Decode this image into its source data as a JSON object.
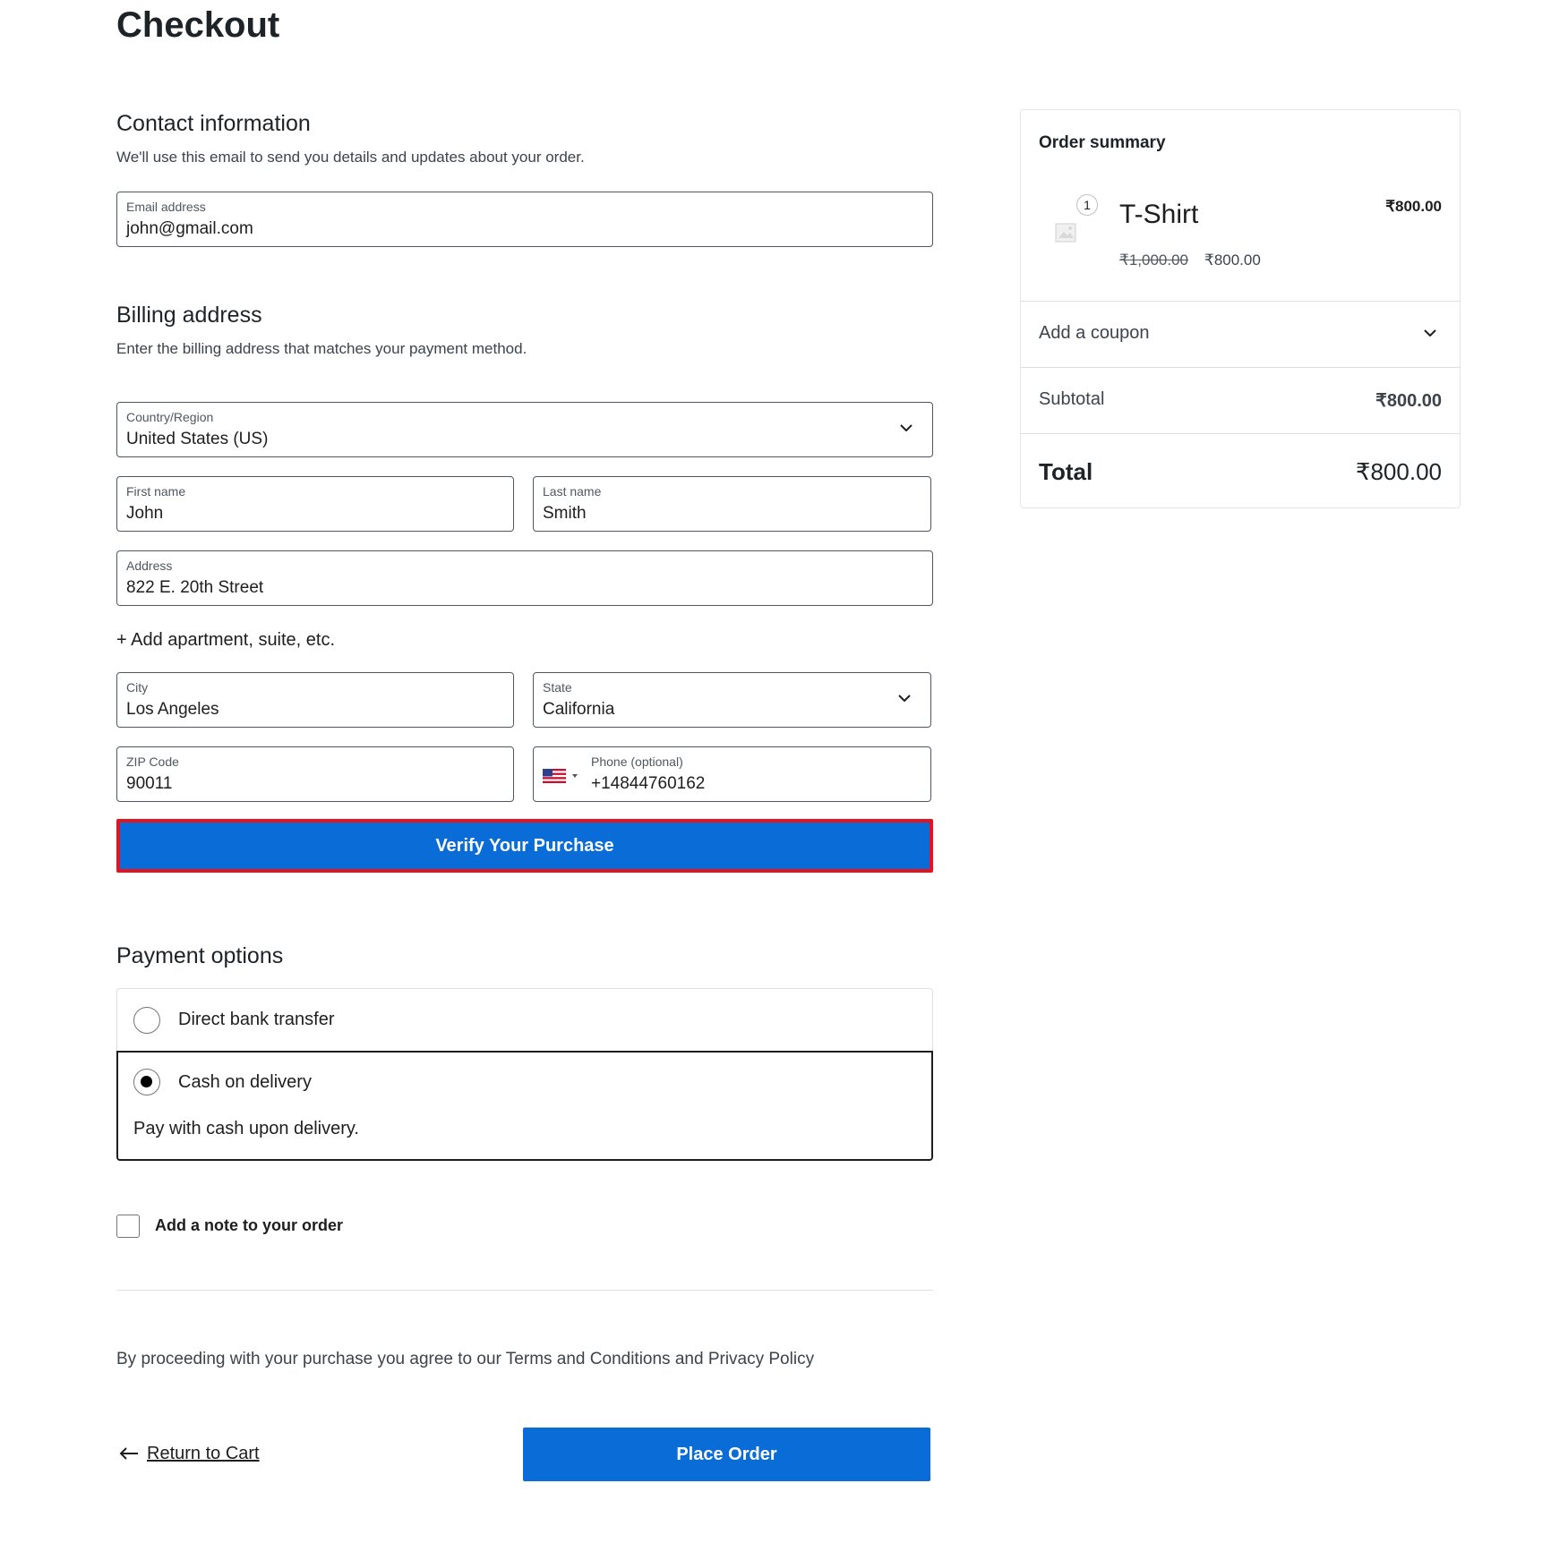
{
  "page": {
    "title": "Checkout"
  },
  "contact": {
    "heading": "Contact information",
    "description": "We'll use this email to send you details and updates about your order.",
    "email_label": "Email address",
    "email_value": "john@gmail.com"
  },
  "billing": {
    "heading": "Billing address",
    "description": "Enter the billing address that matches your payment method.",
    "country_label": "Country/Region",
    "country_value": "United States (US)",
    "first_name_label": "First name",
    "first_name_value": "John",
    "last_name_label": "Last name",
    "last_name_value": "Smith",
    "address_label": "Address",
    "address_value": "822 E. 20th Street",
    "add_apartment": "+ Add apartment, suite, etc.",
    "city_label": "City",
    "city_value": "Los Angeles",
    "state_label": "State",
    "state_value": "California",
    "zip_label": "ZIP Code",
    "zip_value": "90011",
    "phone_label": "Phone (optional)",
    "phone_value": "+14844760162"
  },
  "verify_button": "Verify Your Purchase",
  "payment": {
    "heading": "Payment options",
    "options": [
      {
        "label": "Direct bank transfer",
        "selected": false
      },
      {
        "label": "Cash on delivery",
        "selected": true,
        "description": "Pay with cash upon delivery."
      }
    ]
  },
  "note": {
    "label": "Add a note to your order"
  },
  "terms": "By proceeding with your purchase you agree to our Terms and Conditions and Privacy Policy",
  "return_link": "Return to Cart",
  "place_order": "Place Order",
  "summary": {
    "heading": "Order summary",
    "item": {
      "quantity": "1",
      "name": "T-Shirt",
      "line_total": "₹800.00",
      "original_price": "₹1,000.00",
      "sale_price": "₹800.00"
    },
    "coupon_label": "Add a coupon",
    "subtotal_label": "Subtotal",
    "subtotal_value": "₹800.00",
    "total_label": "Total",
    "total_value": "₹800.00"
  },
  "colors": {
    "accent": "#0a6cd6",
    "highlight_border": "#e3141e"
  }
}
